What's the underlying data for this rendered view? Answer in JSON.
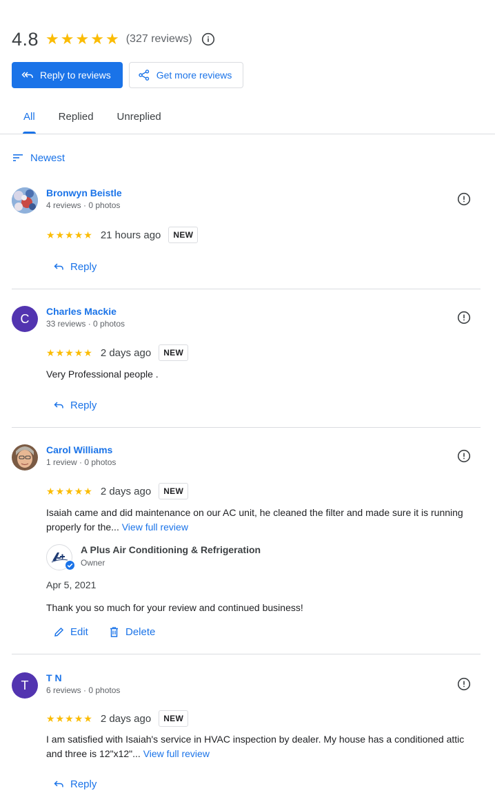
{
  "summary": {
    "rating": "4.8",
    "stars": 5,
    "count": "(327 reviews)"
  },
  "actions": {
    "reply_all": "Reply to reviews",
    "get_more": "Get more reviews"
  },
  "tabs": [
    {
      "label": "All",
      "active": true
    },
    {
      "label": "Replied",
      "active": false
    },
    {
      "label": "Unreplied",
      "active": false
    }
  ],
  "sort": {
    "label": "Newest"
  },
  "reviews": [
    {
      "name": "Bronwyn Beistle",
      "meta": "4 reviews · 0 photos",
      "stars": 5,
      "time": "21 hours ago",
      "badge": "NEW",
      "action": "Reply"
    },
    {
      "name": "Charles Mackie",
      "initial": "C",
      "meta": "33 reviews · 0 photos",
      "stars": 5,
      "time": "2 days ago",
      "badge": "NEW",
      "text": "Very Professional people .",
      "action": "Reply"
    },
    {
      "name": "Carol Williams",
      "meta": "1 review · 0 photos",
      "stars": 5,
      "time": "2 days ago",
      "badge": "NEW",
      "text": "Isaiah came and did maintenance on our AC unit, he cleaned the filter and made sure it is running properly for the...",
      "view_full": "View full review",
      "owner_reply": {
        "business": "A Plus Air Conditioning & Refrigeration",
        "role": "Owner",
        "date": "Apr 5, 2021",
        "text": "Thank you so much for your review and continued business!",
        "edit": "Edit",
        "delete": "Delete"
      }
    },
    {
      "name": "T N",
      "initial": "T",
      "meta": "6 reviews · 0 photos",
      "stars": 5,
      "time": "2 days ago",
      "badge": "NEW",
      "text": "I am satisfied with Isaiah's service in HVAC inspection by dealer. My house has a conditioned attic and three is 12\"x12\"...",
      "view_full": "View full review",
      "action": "Reply"
    }
  ],
  "colors": {
    "accent": "#1a73e8",
    "star": "#fbbc04",
    "avatar_purple": "#5234b0"
  }
}
